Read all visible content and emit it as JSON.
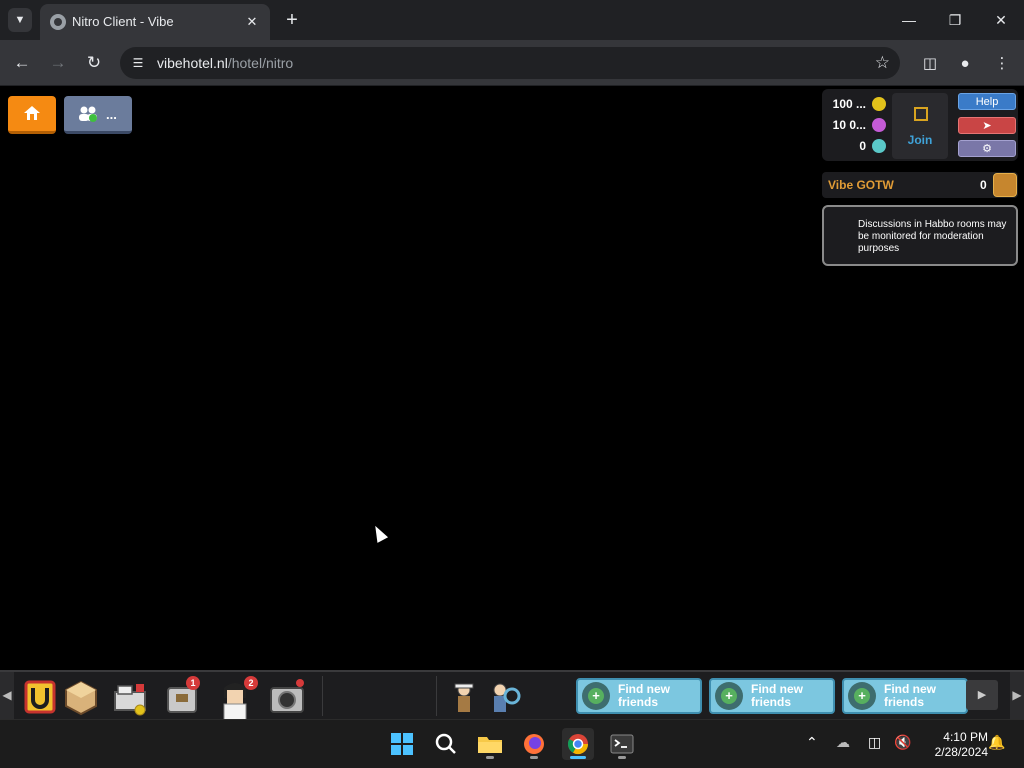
{
  "browser": {
    "tab_title": "Nitro Client - Vibe",
    "url_host": "vibehotel.nl",
    "url_path": "/hotel/nitro"
  },
  "game": {
    "friends_button_text": "...",
    "purse": {
      "credits": "100 ...",
      "duckets": "10 0...",
      "diamonds": "0",
      "club_join_label": "Join",
      "help_label": "Help"
    },
    "gotw": {
      "label": "Vibe GOTW",
      "count": "0"
    },
    "notice": "Discussions in Habbo rooms may be monitored for moderation purposes",
    "toolbar": {
      "badges": [
        "1",
        "2"
      ],
      "find_friends": [
        "Find new friends",
        "Find new friends",
        "Find new friends"
      ]
    }
  },
  "taskbar": {
    "time": "4:10 PM",
    "date": "2/28/2024"
  },
  "colors": {
    "home_button": "#f58a12",
    "credits": "#e2c21b",
    "duckets": "#c45bd6",
    "diamonds": "#5ac8c8",
    "help_button": "#3a7bc8",
    "logout_button": "#c94545",
    "settings_button": "#7a77a8",
    "gotw_label": "#e19c36"
  }
}
